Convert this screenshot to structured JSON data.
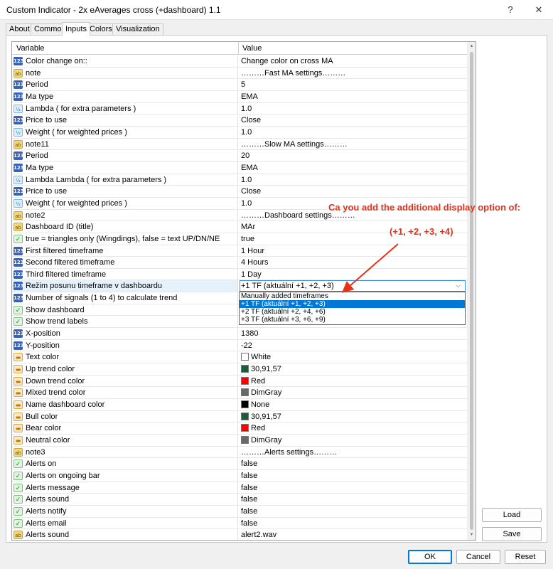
{
  "window": {
    "title": "Custom Indicator - 2x eAverages cross (+dashboard) 1.1",
    "help": "?",
    "close": "✕"
  },
  "tabs": [
    "About",
    "Common",
    "Inputs",
    "Colors",
    "Visualization"
  ],
  "grid": {
    "col_variable": "Variable",
    "col_value": "Value",
    "rows": [
      {
        "icon": "int",
        "name": "Color change on::",
        "value": "Change color on cross MA"
      },
      {
        "icon": "str",
        "name": "note",
        "value": "………Fast MA settings………"
      },
      {
        "icon": "int",
        "name": "Period",
        "value": "5"
      },
      {
        "icon": "int",
        "name": "Ma type",
        "value": "EMA"
      },
      {
        "icon": "dbl",
        "name": "Lambda  ( for extra parameters )",
        "value": "1.0"
      },
      {
        "icon": "int",
        "name": "Price to use",
        "value": "Close"
      },
      {
        "icon": "dbl",
        "name": "Weight  ( for weighted prices )",
        "value": "1.0"
      },
      {
        "icon": "str",
        "name": "note11",
        "value": "………Slow MA settings………"
      },
      {
        "icon": "int",
        "name": "Period",
        "value": "20"
      },
      {
        "icon": "int",
        "name": "Ma type",
        "value": "EMA"
      },
      {
        "icon": "dbl",
        "name": "Lambda  Lambda  ( for extra parameters )",
        "value": "1.0"
      },
      {
        "icon": "int",
        "name": "Price to use",
        "value": "Close"
      },
      {
        "icon": "dbl",
        "name": "Weight  ( for weighted prices )",
        "value": "1.0"
      },
      {
        "icon": "str",
        "name": "note2",
        "value": "………Dashboard settings………"
      },
      {
        "icon": "str",
        "name": "Dashboard ID (title)",
        "value": "MAr"
      },
      {
        "icon": "bool",
        "name": "true = triangles only (Wingdings), false = text UP/DN/NE",
        "value": "true"
      },
      {
        "icon": "int",
        "name": "First filtered timeframe",
        "value": "1 Hour"
      },
      {
        "icon": "int",
        "name": "Second filtered timeframe",
        "value": "4 Hours"
      },
      {
        "icon": "int",
        "name": "Third filtered timeframe",
        "value": "1 Day"
      },
      {
        "icon": "int",
        "name": "Režim posunu timeframe v dashboardu",
        "value": "+1 TF (aktuální +1, +2, +3)",
        "selected": true
      },
      {
        "icon": "int",
        "name": "Number of signals (1 to 4) to calculate trend",
        "value": ""
      },
      {
        "icon": "bool",
        "name": "Show dashboard",
        "value": ""
      },
      {
        "icon": "bool",
        "name": "Show trend labels",
        "value": ""
      },
      {
        "icon": "int",
        "name": "X-position",
        "value": "1380"
      },
      {
        "icon": "int",
        "name": "Y-position",
        "value": "-22"
      },
      {
        "icon": "clr",
        "name": "Text color",
        "value": "White",
        "swatch": "#ffffff"
      },
      {
        "icon": "clr",
        "name": "Up trend color",
        "value": "30,91,57",
        "swatch": "#1e5b39"
      },
      {
        "icon": "clr",
        "name": "Down trend color",
        "value": "Red",
        "swatch": "#ff0000"
      },
      {
        "icon": "clr",
        "name": "Mixed trend color",
        "value": "DimGray",
        "swatch": "#696969"
      },
      {
        "icon": "clr",
        "name": "Name dashboard color",
        "value": "None",
        "swatch": "#000000"
      },
      {
        "icon": "clr",
        "name": "Bull color",
        "value": "30,91,57",
        "swatch": "#1e5b39"
      },
      {
        "icon": "clr",
        "name": "Bear color",
        "value": "Red",
        "swatch": "#ff0000"
      },
      {
        "icon": "clr",
        "name": "Neutral color",
        "value": "DimGray",
        "swatch": "#696969"
      },
      {
        "icon": "str",
        "name": "note3",
        "value": "………Alerts settings………"
      },
      {
        "icon": "bool",
        "name": "Alerts on",
        "value": "false"
      },
      {
        "icon": "bool",
        "name": "Alerts on ongoing bar",
        "value": "false"
      },
      {
        "icon": "bool",
        "name": "Alerts message",
        "value": "false"
      },
      {
        "icon": "bool",
        "name": "Alerts sound",
        "value": "false"
      },
      {
        "icon": "bool",
        "name": "Alerts notify",
        "value": "false"
      },
      {
        "icon": "bool",
        "name": "Alerts email",
        "value": "false"
      },
      {
        "icon": "str",
        "name": "Alerts sound",
        "value": "alert2.wav"
      }
    ]
  },
  "icon_glyphs": {
    "int": "123",
    "str": "ab",
    "dbl": "½",
    "bool": "✓",
    "clr": "▬"
  },
  "dropdown": {
    "options": [
      "Manually added  timeframes",
      "+1 TF (aktuální +1, +2, +3)",
      "+2 TF (aktuální +2, +4, +6)",
      "+3 TF (aktuální +3, +6, +9)"
    ],
    "highlighted": 1
  },
  "annotation": {
    "line1": "Ca you add the additional display option of:",
    "line2": "(+1, +2, +3, +4)",
    "color": "#e8311a"
  },
  "buttons": {
    "load": "Load",
    "save": "Save",
    "ok": "OK",
    "cancel": "Cancel",
    "reset": "Reset"
  }
}
